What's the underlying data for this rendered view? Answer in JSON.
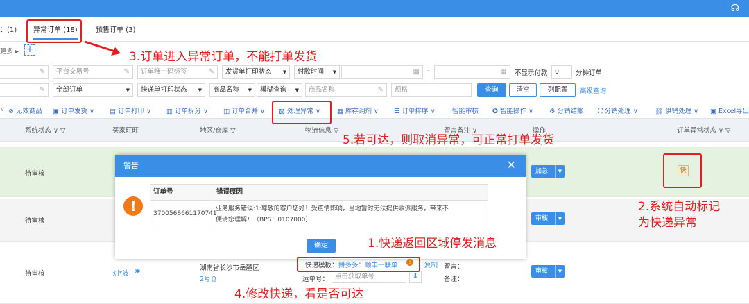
{
  "tabs": {
    "first_partial": "：(1)",
    "abnormal": "异常订单 (18)",
    "presale": "预售订单 (3)"
  },
  "more_label": "更多 ▸",
  "filters": {
    "row1": {
      "platform_no": "平台交易号",
      "unique_code": "订单唯一码标签",
      "print_status": "发货单打印状态",
      "pay_time": "付款时间",
      "dash": "-",
      "no_show_paid": "不显示付款",
      "minutes_value": "0",
      "minutes_label": "分钟订单"
    },
    "row2": {
      "all_orders": "全部订单",
      "express_print": "快递单打印状态",
      "goods_name_sel": "商品名称",
      "fuzzy": "模糊查询",
      "goods_name_ph": "商品名称",
      "spec_ph": "规格",
      "query": "查询",
      "clear": "清空",
      "column_config": "列配置",
      "advanced": "高级查询"
    }
  },
  "toolbar": [
    "无效商品",
    "订单发货",
    "订单打印",
    "订单拆分",
    "订单合并",
    "处理异常",
    "库存调剂",
    "订单排序",
    "智能审核",
    "智能操作",
    "分销结账",
    "分销处理",
    "供销处理",
    "Excel导出"
  ],
  "headers": {
    "system_status": "系统状态",
    "buyer": "买家旺旺",
    "region": "地区/仓库",
    "logistics": "物流信息",
    "remark": "留言备注",
    "operation": "操作",
    "abnormal_status": "订单异常状态"
  },
  "rows": [
    {
      "status": "待审核",
      "action": "加急"
    },
    {
      "status": "待审核",
      "action": "审核"
    },
    {
      "status": "待审核",
      "action": "审核",
      "buyer": "刘*波",
      "region": "湖南省长沙市岳麓区",
      "warehouse": "2号仓",
      "template_label": "快递模板：",
      "template_value": "拼多多：顺丰一联单",
      "copy": "复制",
      "waybill_label": "运单号：",
      "waybill_ph": "点击获取单号",
      "msg_label": "留言：",
      "note_label": "备注："
    }
  ],
  "kuai_badge": "快",
  "modal": {
    "title": "警告",
    "col_order": "订单号",
    "col_reason": "错误原因",
    "order_no": "3700568661170741",
    "reason_line1": "业务服务错误:1:尊敬的客户您好！受疫情影响，当地暂时无法提供收派服务，带来不",
    "reason_line2": "便请您理解！（BPS：0107000）",
    "confirm": "确定"
  },
  "annotations": {
    "a1": "1.快递返回区域停发消息",
    "a2_line1": "2.系统自动标记",
    "a2_line2": "为快递异常",
    "a3": "3.订单进入异常订单，不能打单发货",
    "a4": "4.修改快递，看是否可达",
    "a5": "5.若可达，则取消异常，可正常打单发货"
  },
  "colors": {
    "primary": "#3a8ee6",
    "annotation_red": "#e02020",
    "warning_orange": "#f07a17",
    "row_green": "#e6f2e0"
  }
}
